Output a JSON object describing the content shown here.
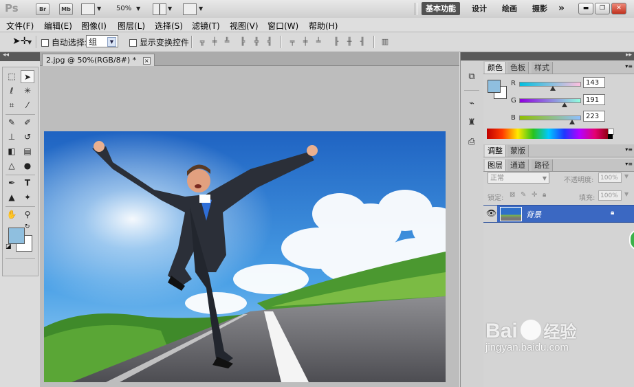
{
  "app": {
    "logo": "Ps",
    "bridge_label": "Br",
    "minibridge_label": "Mb",
    "zoom": "50%",
    "workspaces": [
      "基本功能",
      "设计",
      "绘画",
      "摄影"
    ],
    "more": "»"
  },
  "menu": [
    "文件(F)",
    "编辑(E)",
    "图像(I)",
    "图层(L)",
    "选择(S)",
    "滤镜(T)",
    "视图(V)",
    "窗口(W)",
    "帮助(H)"
  ],
  "options": {
    "auto_select_label": "自动选择:",
    "auto_select_value": "组",
    "show_transform_label": "显示变换控件"
  },
  "document": {
    "tab_title": "2.jpg @ 50%(RGB/8#) *",
    "close_glyph": "×"
  },
  "color_panel": {
    "tabs": [
      "颜色",
      "色板",
      "样式"
    ],
    "r_label": "R",
    "r_value": "143",
    "g_label": "G",
    "g_value": "191",
    "b_label": "B",
    "b_value": "223",
    "r_level": 143,
    "g_level": 191,
    "b_level": 223,
    "foreground": "#8fbfdf"
  },
  "adjust_panel": {
    "tabs": [
      "调整",
      "蒙版"
    ]
  },
  "layers_panel": {
    "tabs": [
      "图层",
      "通道",
      "路径"
    ],
    "blend_mode": "正常",
    "opacity_label": "不透明度:",
    "opacity_value": "100%",
    "lock_label": "锁定:",
    "fill_label": "填充:",
    "fill_value": "100%",
    "layer_name": "背景"
  },
  "watermark": {
    "brand": "Bai",
    "brand2": "经验",
    "url": "jingyan.baidu.com"
  }
}
